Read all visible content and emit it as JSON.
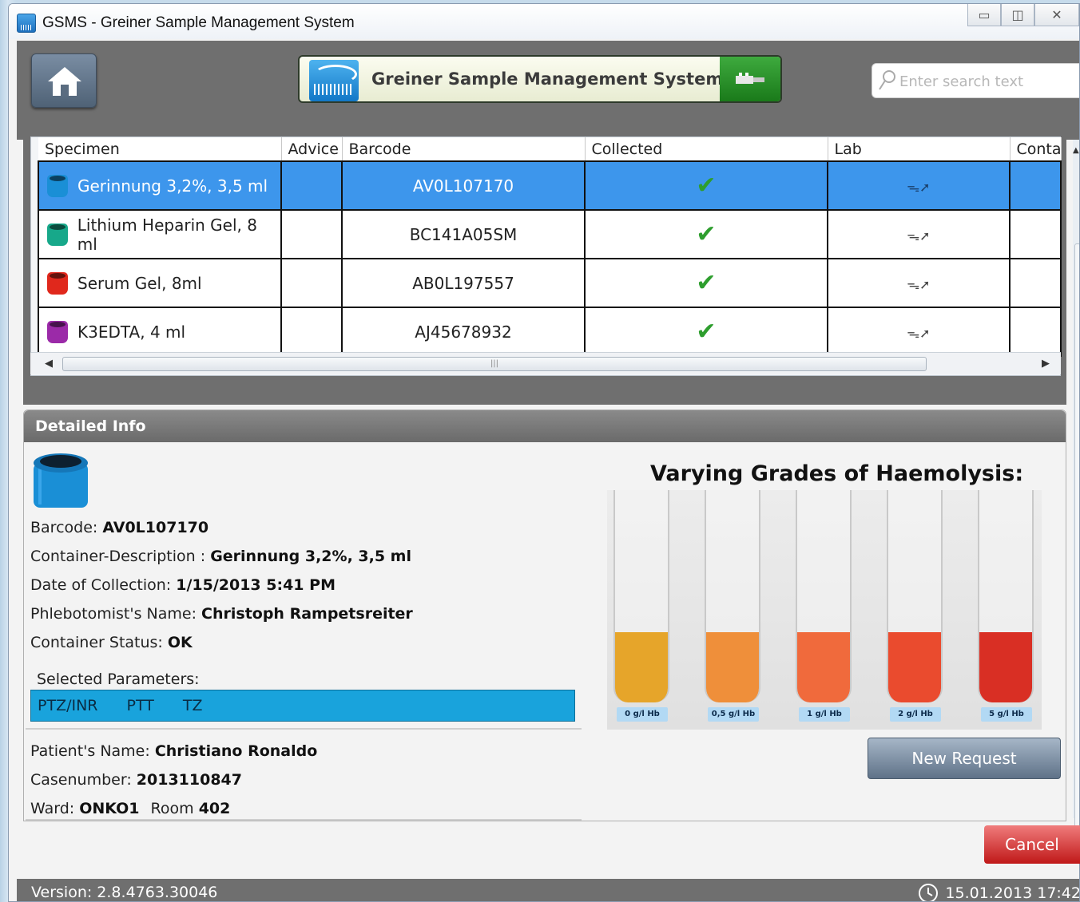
{
  "window": {
    "title": "GSMS - Greiner Sample Management System",
    "minimize_icon": "minimize-icon",
    "maximize_icon": "maximize-icon",
    "close_icon": "close-icon"
  },
  "header": {
    "brand_title": "Greiner Sample Management System",
    "search_placeholder": "Enter search text"
  },
  "grid": {
    "columns": [
      "Specimen",
      "Advice",
      "Barcode",
      "Collected",
      "Lab",
      "Conta"
    ],
    "rows": [
      {
        "specimen": "Gerinnung 3,2%, 3,5 ml",
        "advice": "",
        "barcode": "AV0L107170",
        "collected": "✔",
        "lab": "ᯓ➚",
        "tube_color": "#1a8fd6",
        "selected": true
      },
      {
        "specimen": "Lithium Heparin Gel, 8 ml",
        "advice": "",
        "barcode": "BC141A05SM",
        "collected": "✔",
        "lab": "ᯓ➚",
        "tube_color": "#17a88a",
        "selected": false
      },
      {
        "specimen": "Serum Gel, 8ml",
        "advice": "",
        "barcode": "AB0L197557",
        "collected": "✔",
        "lab": "ᯓ➚",
        "tube_color": "#e0281c",
        "selected": false
      },
      {
        "specimen": "K3EDTA, 4 ml",
        "advice": "",
        "barcode": "AJ45678932",
        "collected": "✔",
        "lab": "ᯓ➚",
        "tube_color": "#9b2aa8",
        "selected": false
      }
    ],
    "scroll_grip": "|||"
  },
  "details": {
    "header": "Detailed Info",
    "barcode_label": "Barcode:",
    "barcode_value": "AV0L107170",
    "container_label": "Container-Description :",
    "container_value": "Gerinnung 3,2%, 3,5 ml",
    "date_label": "Date of Collection:",
    "date_value": "1/15/2013 5:41 PM",
    "phleb_label": "Phlebotomist's Name:",
    "phleb_value": "Christoph Rampetsreiter",
    "status_label": "Container Status:",
    "status_value": "OK",
    "params_label": "Selected Parameters:",
    "params": [
      "PTZ/INR",
      "PTT",
      "TZ"
    ],
    "patient_label": "Patient's Name:",
    "patient_value": "Christiano Ronaldo",
    "case_label": "Casenumber:",
    "case_value": "2013110847",
    "ward_label": "Ward:",
    "ward_value": "ONKO1",
    "room_label": "Room",
    "room_value": "402",
    "haemolysis_title": "Varying Grades of Haemolysis:",
    "haemolysis_tubes": [
      {
        "label": "0 g/l Hb",
        "color": "#e6a52a"
      },
      {
        "label": "0,5 g/l Hb",
        "color": "#ef8f3a"
      },
      {
        "label": "1 g/l Hb",
        "color": "#f06a3c"
      },
      {
        "label": "2 g/l Hb",
        "color": "#ea4b2e"
      },
      {
        "label": "5 g/l Hb",
        "color": "#d92f24"
      }
    ],
    "new_request": "New Request"
  },
  "cancel": "Cancel",
  "status": {
    "version": "Version: 2.8.4763.30046",
    "datetime": "15.01.2013 17:42"
  }
}
